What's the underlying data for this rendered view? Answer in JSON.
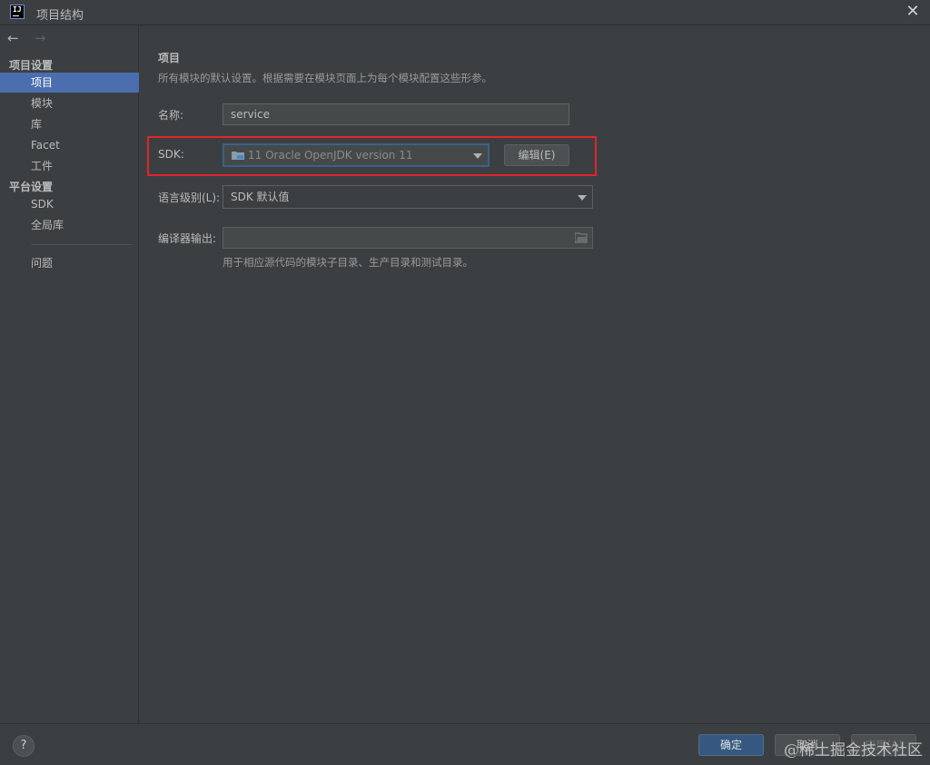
{
  "window": {
    "title": "项目结构",
    "close_icon": "close-icon"
  },
  "nav": {
    "back": "←",
    "forward": "→"
  },
  "sidebar": {
    "project_settings_header": "项目设置",
    "project_items": [
      "项目",
      "模块",
      "库",
      "Facet",
      "工件"
    ],
    "platform_settings_header": "平台设置",
    "platform_items": [
      "SDK",
      "全局库"
    ],
    "problems": "问题",
    "selected": "项目"
  },
  "main": {
    "title": "项目",
    "description": "所有模块的默认设置。根据需要在模块页面上为每个模块配置这些形参。",
    "name_label": "名称:",
    "name_value": "service",
    "sdk_label": "SDK:",
    "sdk_value": "11  Oracle OpenJDK version 11",
    "edit_button": "编辑(E)",
    "language_level_label": "语言级别(L):",
    "language_level_value": "SDK 默认值",
    "compiler_output_label": "编译器输出:",
    "compiler_output_value": "",
    "compiler_output_hint": "用于相应源代码的模块子目录、生产目录和测试目录。"
  },
  "footer": {
    "help": "?",
    "ok": "确定",
    "cancel": "取消",
    "apply": "应用(A)",
    "watermark": "@稀土掘金技术社区"
  },
  "colors": {
    "background": "#3c3f41",
    "selection": "#4b6eaf",
    "highlight_border": "#e0242b",
    "primary_button": "#365880"
  }
}
